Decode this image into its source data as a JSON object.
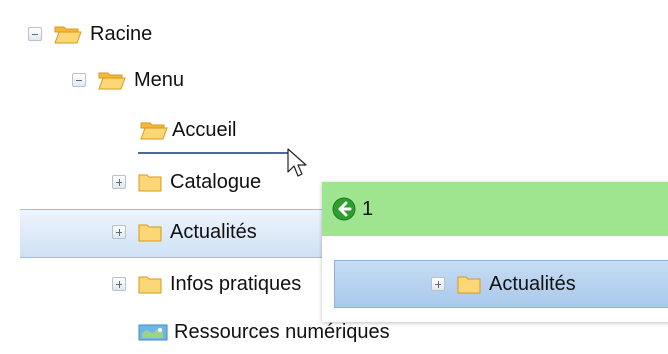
{
  "tree": {
    "nodes": [
      {
        "id": "racine",
        "label": "Racine",
        "toggle": "minus",
        "icon": "folder-open-icon"
      },
      {
        "id": "menu",
        "label": "Menu",
        "toggle": "minus",
        "icon": "folder-open-icon"
      },
      {
        "id": "accueil",
        "label": "Accueil",
        "toggle": "none",
        "icon": "folder-open-icon"
      },
      {
        "id": "catalogue",
        "label": "Catalogue",
        "toggle": "plus",
        "icon": "folder-icon"
      },
      {
        "id": "actualites",
        "label": "Actualités",
        "toggle": "plus",
        "icon": "folder-icon",
        "selected": true
      },
      {
        "id": "infos-pratiques",
        "label": "Infos pratiques",
        "toggle": "plus",
        "icon": "folder-icon"
      },
      {
        "id": "ressources",
        "label": "Ressources numériques",
        "toggle": "none",
        "icon": "map-icon"
      }
    ]
  },
  "drag_proxy": {
    "status_icon": "green-arrow-left-icon",
    "count": "1",
    "item_label": "Actualités",
    "item_icon": "folder-icon",
    "status_color": "#9fe58f"
  },
  "colors": {
    "selection": "#cfe1f4",
    "folder": "#f5c34b",
    "drop_indicator": "#4a6a9a"
  }
}
